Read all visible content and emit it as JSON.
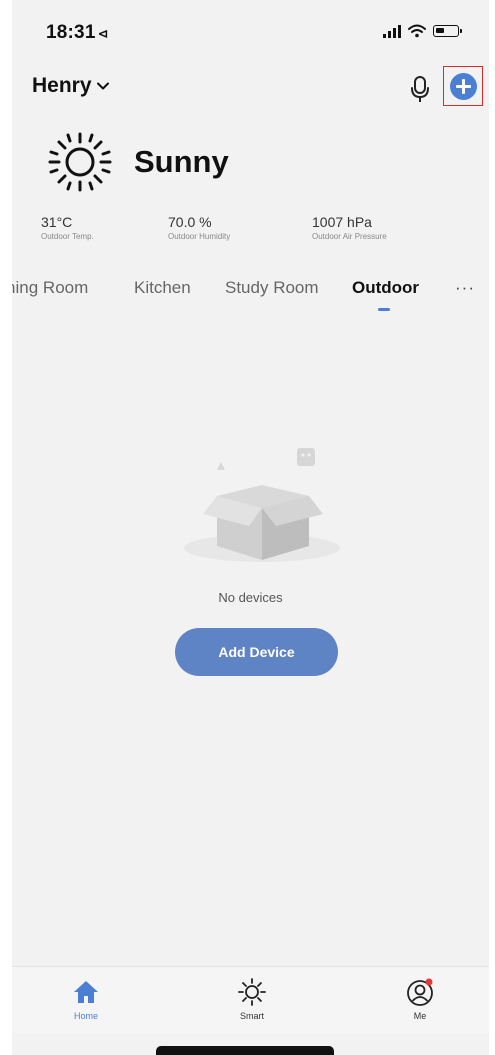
{
  "status_bar": {
    "time": "18:31",
    "location_glyph": "⊲"
  },
  "header": {
    "home_name": "Henry",
    "chevron": "⌄",
    "mic_icon": "microphone-icon",
    "add_icon": "plus-circle-icon"
  },
  "weather": {
    "condition": "Sunny",
    "icon": "sun-icon",
    "stats": [
      {
        "value": "31°C",
        "label": "Outdoor Temp."
      },
      {
        "value": "70.0 %",
        "label": "Outdoor Humidity"
      },
      {
        "value": "1007 hPa",
        "label": "Outdoor Air Pressure"
      }
    ]
  },
  "rooms": {
    "tabs": [
      {
        "label": "Dining Room"
      },
      {
        "label": "Kitchen"
      },
      {
        "label": "Study Room"
      },
      {
        "label": "Outdoor",
        "active": true
      }
    ],
    "more_label": "···"
  },
  "empty_state": {
    "message": "No devices",
    "button_label": "Add Device"
  },
  "tab_bar": {
    "items": [
      {
        "label": "Home",
        "icon": "home-icon",
        "active": true
      },
      {
        "label": "Smart",
        "icon": "smart-sun-icon",
        "active": false
      },
      {
        "label": "Me",
        "icon": "user-icon",
        "active": false,
        "badge": true
      }
    ]
  },
  "colors": {
    "accent": "#4a7fd4",
    "button": "#5f84c6",
    "highlight_box": "#d32f2f",
    "badge": "#e53935",
    "background": "#f2f2f2"
  }
}
